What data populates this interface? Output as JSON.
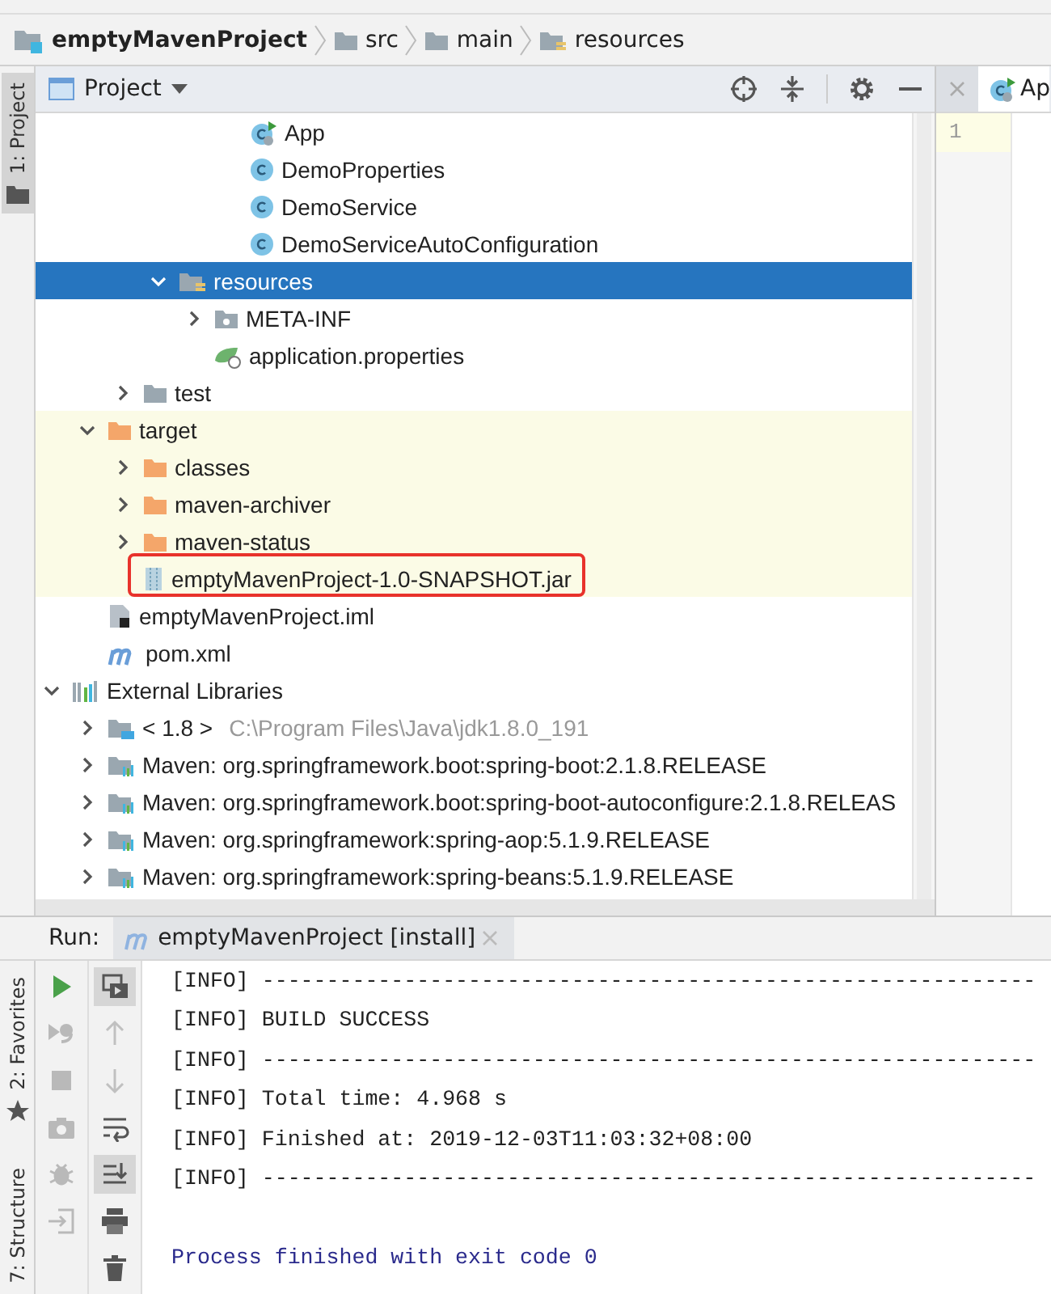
{
  "breadcrumb": [
    {
      "label": "emptyMavenProject",
      "kind": "module"
    },
    {
      "label": "src",
      "kind": "folder"
    },
    {
      "label": "main",
      "kind": "folder"
    },
    {
      "label": "resources",
      "kind": "resource-folder"
    }
  ],
  "left_stripe_top": [
    {
      "label": "1: Project",
      "selected": true
    }
  ],
  "project_panel": {
    "title": "Project",
    "tree": [
      {
        "kind": "continuation",
        "children": [
          {
            "kind": "continuation",
            "children": [
              {
                "kind": "continuation",
                "children": [
                  {
                    "kind": "continuation",
                    "children": [
                      {
                        "kind": "continuation",
                        "children": [
                          {
                            "label": "App",
                            "kind": "main-class",
                            "selected": false
                          },
                          {
                            "label": "DemoProperties",
                            "kind": "class",
                            "selected": false
                          },
                          {
                            "label": "DemoService",
                            "kind": "class",
                            "selected": false
                          },
                          {
                            "label": "DemoServiceAutoConfiguration",
                            "kind": "class",
                            "selected": false
                          }
                        ]
                      }
                    ]
                  },
                  {
                    "label": "resources",
                    "kind": "resource-folder",
                    "selected": true,
                    "expanded": true,
                    "children": [
                      {
                        "label": "META-INF",
                        "kind": "package-folder",
                        "selected": false,
                        "expanded": false
                      },
                      {
                        "label": "application.properties",
                        "kind": "properties",
                        "selected": false
                      }
                    ]
                  }
                ]
              },
              {
                "label": "test",
                "kind": "folder",
                "selected": false,
                "expanded": false
              }
            ]
          },
          {
            "label": "target",
            "kind": "folder",
            "selected": false,
            "expanded": true,
            "excluded": true,
            "children": [
              {
                "label": "classes",
                "kind": "folder",
                "selected": false,
                "expanded": false
              },
              {
                "label": "maven-archiver",
                "kind": "folder",
                "selected": false,
                "expanded": false
              },
              {
                "label": "maven-status",
                "kind": "folder",
                "selected": false,
                "expanded": false
              },
              {
                "label": "emptyMavenProject-1.0-SNAPSHOT.jar",
                "kind": "jar",
                "selected": false,
                "outlined": true
              }
            ]
          },
          {
            "label": "emptyMavenProject.iml",
            "kind": "module-file",
            "selected": false
          },
          {
            "label": "pom.xml",
            "kind": "pom",
            "selected": false
          }
        ]
      },
      {
        "label": "External Libraries",
        "kind": "libraries",
        "selected": false,
        "expanded": true,
        "children": [
          {
            "label": "< 1.8 >",
            "detail": "C:\\Program Files\\Java\\jdk1.8.0_191",
            "kind": "jdk",
            "selected": false,
            "expanded": false
          },
          {
            "label": "Maven: org.springframework.boot:spring-boot:2.1.8.RELEASE",
            "kind": "library",
            "selected": false,
            "expanded": false
          },
          {
            "label": "Maven: org.springframework.boot:spring-boot-autoconfigure:2.1.8.RELEAS",
            "kind": "library",
            "selected": false,
            "expanded": false
          },
          {
            "label": "Maven: org.springframework:spring-aop:5.1.9.RELEASE",
            "kind": "library",
            "selected": false,
            "expanded": false
          },
          {
            "label": "Maven: org.springframework:spring-beans:5.1.9.RELEASE",
            "kind": "library",
            "selected": false,
            "expanded": false
          }
        ]
      }
    ]
  },
  "editor": {
    "tabs": [
      {
        "label": "Ap",
        "selected": true
      }
    ],
    "line_numbers": [
      "1"
    ]
  },
  "run_panel": {
    "label": "Run:",
    "tabs": [
      {
        "label": "emptyMavenProject [install]",
        "selected": true
      }
    ],
    "toolbar_left": [
      {
        "kind": "run",
        "disabled": false
      },
      {
        "kind": "rerun",
        "disabled": true
      },
      {
        "kind": "stop",
        "disabled": true
      },
      {
        "kind": "camera",
        "disabled": true
      },
      {
        "kind": "bug",
        "disabled": true
      },
      {
        "kind": "enter",
        "disabled": true
      }
    ],
    "toolbar_right": [
      {
        "kind": "layout",
        "disabled": false,
        "on": true
      },
      {
        "kind": "up",
        "disabled": true,
        "on": false
      },
      {
        "kind": "down",
        "disabled": true,
        "on": false
      },
      {
        "kind": "wrap",
        "disabled": false,
        "on": false
      },
      {
        "kind": "scroll-end",
        "disabled": false,
        "on": true
      },
      {
        "kind": "print",
        "disabled": false,
        "on": false
      },
      {
        "kind": "trash",
        "disabled": false,
        "on": false
      }
    ],
    "console": [
      {
        "kind": "log",
        "text": "[INFO] ------------------------------------------------------------"
      },
      {
        "kind": "log",
        "text": "[INFO] BUILD SUCCESS"
      },
      {
        "kind": "log",
        "text": "[INFO] ------------------------------------------------------------"
      },
      {
        "kind": "log",
        "text": "[INFO] Total time:  4.968 s"
      },
      {
        "kind": "log",
        "text": "[INFO] Finished at: 2019-12-03T11:03:32+08:00"
      },
      {
        "kind": "log",
        "text": "[INFO] ------------------------------------------------------------"
      },
      {
        "kind": "blank"
      },
      {
        "kind": "status",
        "text": "Process finished with exit code 0"
      }
    ]
  },
  "left_stripe_bottom": [
    {
      "label": "2: Favorites",
      "selected": false,
      "kind": "favorites"
    },
    {
      "label": "7: Structure",
      "selected": false,
      "kind": "structure"
    }
  ]
}
